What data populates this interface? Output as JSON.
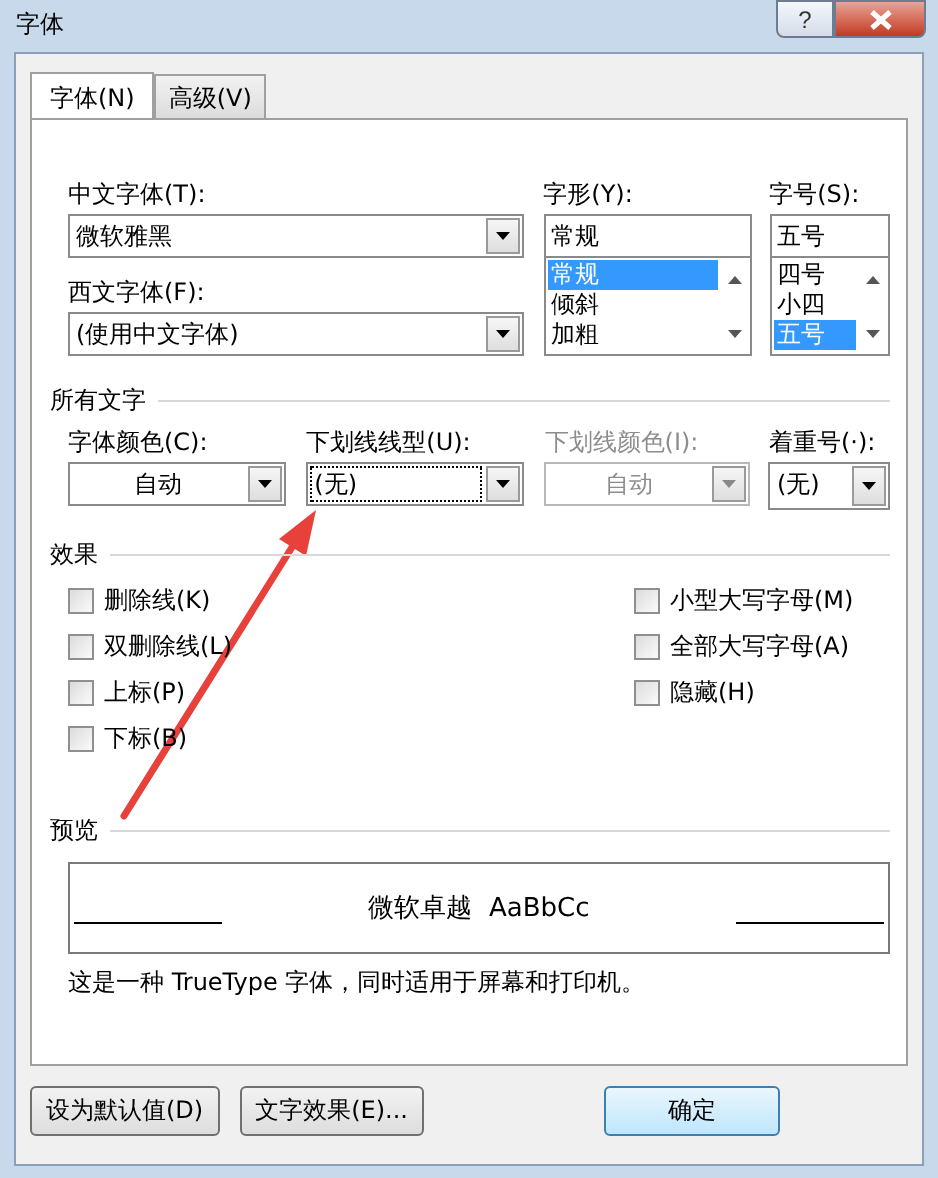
{
  "window": {
    "title": "字体",
    "help_label": "?"
  },
  "tabs": [
    {
      "label": "字体(N)",
      "selected": true
    },
    {
      "label": "高级(V)",
      "selected": false
    }
  ],
  "font_section": {
    "chinese_font": {
      "label": "中文字体(T):",
      "value": "微软雅黑"
    },
    "western_font": {
      "label": "西文字体(F):",
      "value": "(使用中文字体)"
    },
    "style": {
      "label": "字形(Y):",
      "value": "常规",
      "options": [
        {
          "label": "常规",
          "selected": true
        },
        {
          "label": "倾斜",
          "selected": false
        },
        {
          "label": "加粗",
          "selected": false
        }
      ]
    },
    "size": {
      "label": "字号(S):",
      "value": "五号",
      "options": [
        {
          "label": "四号",
          "selected": false
        },
        {
          "label": "小四",
          "selected": false
        },
        {
          "label": "五号",
          "selected": true
        }
      ]
    }
  },
  "all_text": {
    "title": "所有文字",
    "fields": [
      {
        "kind": "color",
        "label": "字体颜色(C):",
        "value": "自动",
        "disabled": false,
        "focused": false
      },
      {
        "kind": "list",
        "label": "下划线线型(U):",
        "value": "(无)",
        "disabled": false,
        "focused": true
      },
      {
        "kind": "color",
        "label": "下划线颜色(I):",
        "value": "自动",
        "disabled": true,
        "focused": false
      },
      {
        "kind": "list",
        "label": "着重号(·):",
        "value": "(无)",
        "disabled": false,
        "focused": false
      }
    ]
  },
  "effects": {
    "title": "效果",
    "left": [
      {
        "label": "删除线(K)",
        "checked": false
      },
      {
        "label": "双删除线(L)",
        "checked": false
      },
      {
        "label": "上标(P)",
        "checked": false
      },
      {
        "label": "下标(B)",
        "checked": false
      }
    ],
    "right": [
      {
        "label": "小型大写字母(M)",
        "checked": false
      },
      {
        "label": "全部大写字母(A)",
        "checked": false
      },
      {
        "label": "隐藏(H)",
        "checked": false
      }
    ]
  },
  "preview": {
    "title": "预览",
    "sample": "微软卓越  AaBbCc",
    "description": "这是一种 TrueType 字体，同时适用于屏幕和打印机。"
  },
  "buttons": [
    "设为默认值(D)",
    "文字效果(E)...",
    "确定"
  ],
  "annotation": {
    "kind": "arrow"
  }
}
